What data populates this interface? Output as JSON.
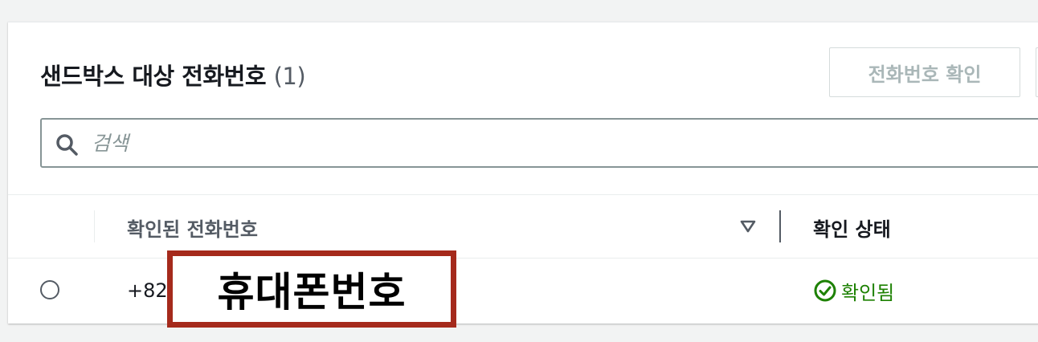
{
  "header": {
    "title": "샌드박스 대상 전화번호",
    "count": "(1)",
    "verify_button_label": "전화번호 확인"
  },
  "search": {
    "placeholder": "검색",
    "value": ""
  },
  "table": {
    "columns": [
      "확인된 전화번호",
      "확인 상태"
    ],
    "rows": [
      {
        "phone": "+82",
        "status": "확인됨"
      }
    ]
  },
  "annotation": {
    "label": "휴대폰번호"
  },
  "colors": {
    "status_success": "#1d8102",
    "annotation_border": "#a52a1c"
  },
  "icons": [
    "search-icon",
    "sort-descending-icon",
    "check-circle-icon"
  ]
}
